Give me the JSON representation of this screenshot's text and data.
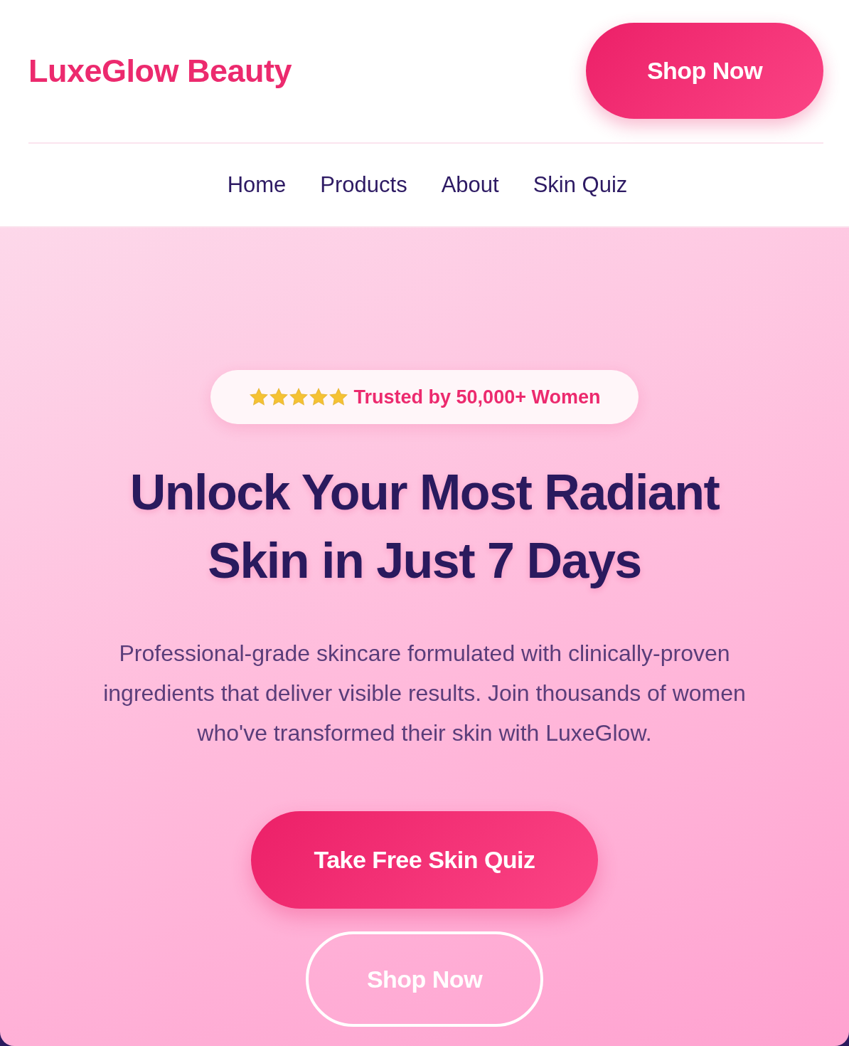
{
  "header": {
    "logo": "LuxeGlow Beauty",
    "cta": "Shop Now"
  },
  "nav": [
    {
      "label": "Home"
    },
    {
      "label": "Products"
    },
    {
      "label": "About"
    },
    {
      "label": "Skin Quiz"
    }
  ],
  "hero": {
    "badge": {
      "stars": 5,
      "text": "Trusted by 50,000+ Women"
    },
    "title": "Unlock Your Most Radiant Skin in Just 7 Days",
    "subtitle": "Professional-grade skincare formulated with clinically-proven ingredients that deliver visible results. Join thousands of women who've transformed their skin with LuxeGlow.",
    "buttons": [
      {
        "label": "Take Free Skin Quiz",
        "kind": "primary"
      },
      {
        "label": "Shop Now",
        "kind": "outline"
      }
    ]
  }
}
